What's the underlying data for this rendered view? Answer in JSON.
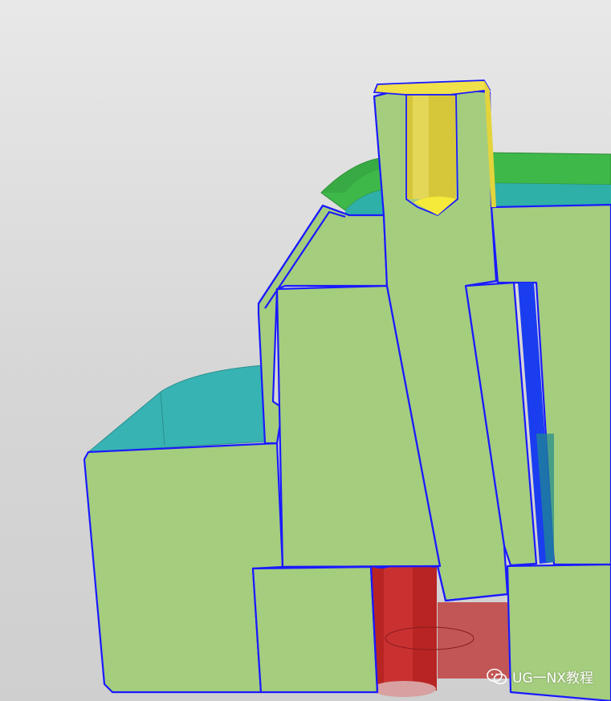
{
  "watermark": {
    "text": "UG一NX教程",
    "icon": "wechat-icon"
  },
  "colors": {
    "background_top": "#e8e8e8",
    "background_bottom": "#cfcfcf",
    "section_face": "#a5cd7e",
    "section_edge": "#1a1aff",
    "cooling_pin_yellow": "#d6c73a",
    "cavity_green": "#3fb84a",
    "runner_cyan": "#38b3b3",
    "ejector_red": "#b82424"
  }
}
